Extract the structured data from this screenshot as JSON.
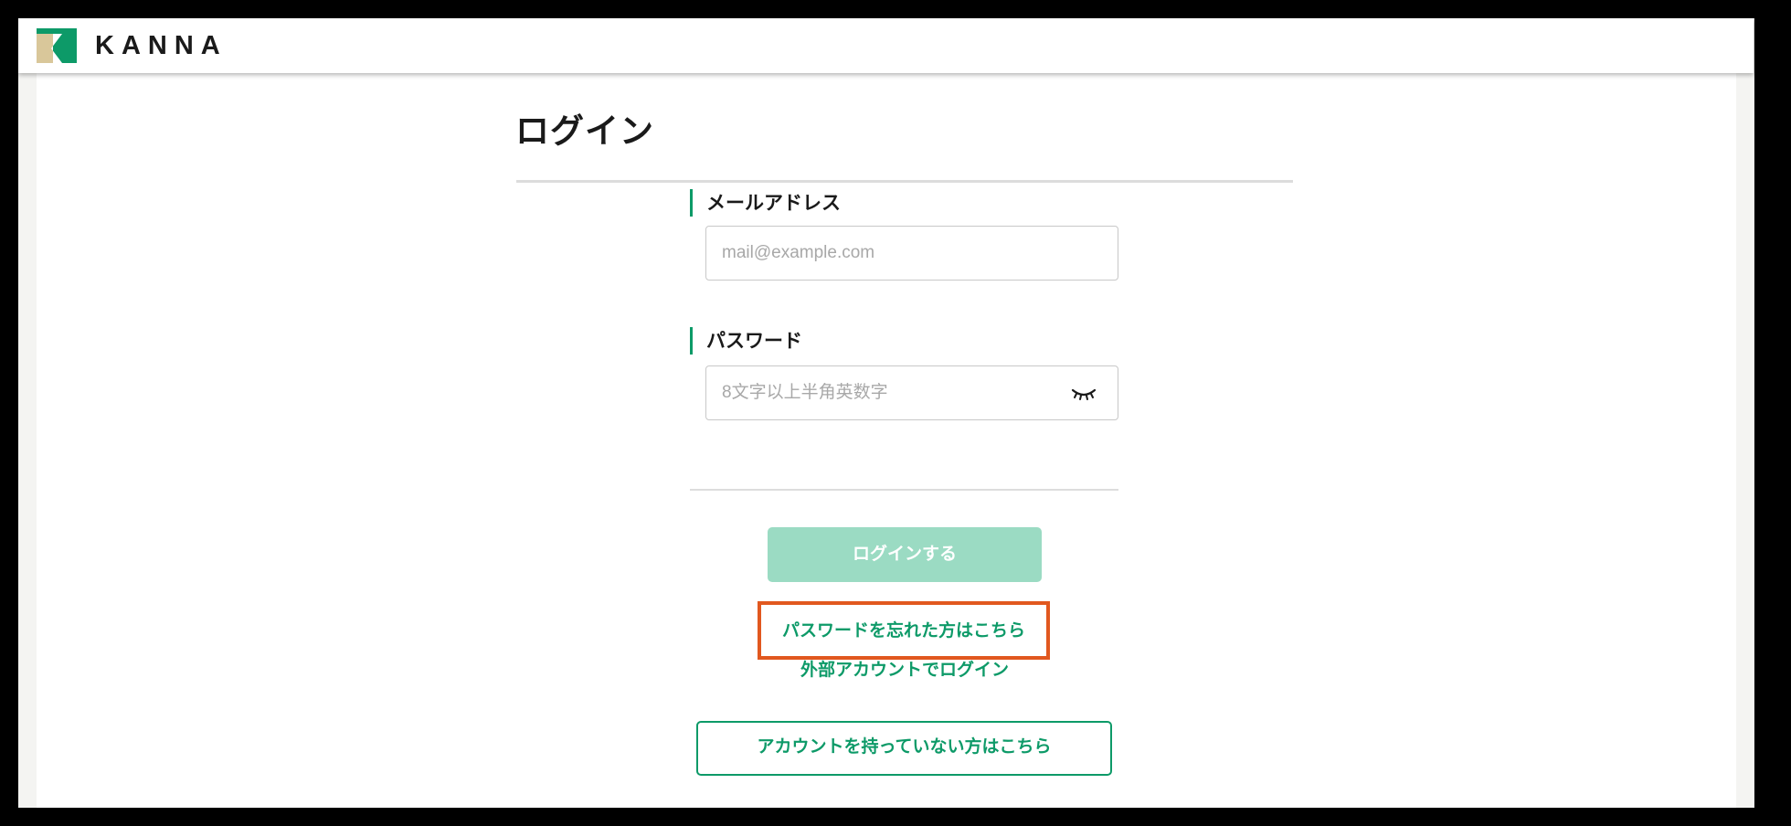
{
  "app": {
    "brand_name": "KANNA",
    "brand_colors": {
      "green": "#0d9a68",
      "tan": "#d9c79a"
    },
    "logo_icon": "kanna-logo-icon"
  },
  "page": {
    "title": "ログイン"
  },
  "form": {
    "email_label": "メールアドレス",
    "email_placeholder": "mail@example.com",
    "password_label": "パスワード",
    "password_placeholder": "8文字以上半角英数字",
    "password_toggle_icon": "eye-closed-icon"
  },
  "actions": {
    "login_label": "ログインする",
    "login_state": "disabled",
    "forgot_password_label": "パスワードを忘れた方はこちら",
    "external_login_label": "外部アカウントでログイン",
    "signup_label": "アカウントを持っていない方はこちら"
  },
  "colors": {
    "accent": "#0d9a68",
    "login_button_disabled": "#9bdbc3",
    "highlight_border": "#e1581f"
  },
  "scrollbar": {
    "up_icon": "scroll-up-arrow-icon",
    "down_icon": "scroll-down-arrow-icon"
  }
}
